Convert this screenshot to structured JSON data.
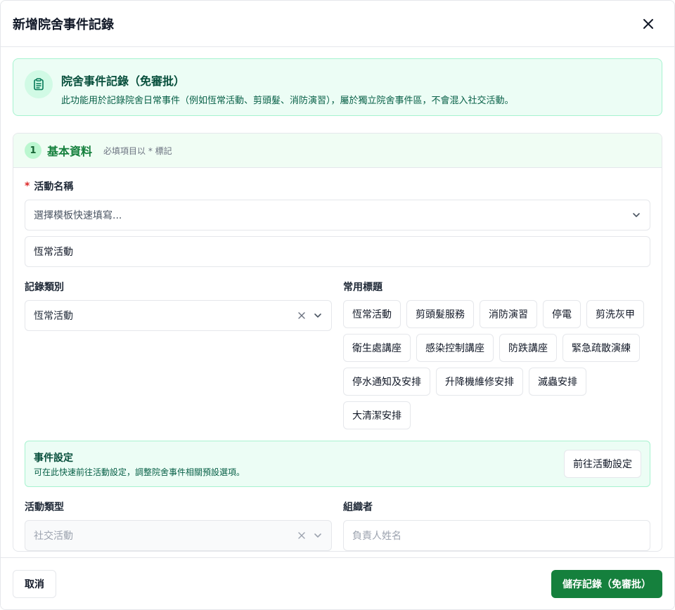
{
  "dialog": {
    "title": "新增院舍事件記錄"
  },
  "banner": {
    "title": "院舍事件記錄（免審批）",
    "description": "此功能用於記錄院舍日常事件（例如恆常活動、剪頭髮、消防演習），屬於獨立院舍事件區，不會混入社交活動。"
  },
  "section": {
    "step": "1",
    "title": "基本資料",
    "hint": "必填項目以 * 標記",
    "activity_name": {
      "required_mark": "*",
      "label": "活動名稱",
      "template_placeholder": "選擇模板快速填寫...",
      "value": "恆常活動"
    },
    "record_category": {
      "label": "記錄類別",
      "value": "恆常活動"
    },
    "common_tags": {
      "label": "常用標題",
      "items": [
        "恆常活動",
        "剪頭髮服務",
        "消防演習",
        "停電",
        "剪洗灰甲",
        "衛生處講座",
        "感染控制講座",
        "防跌講座",
        "緊急疏散演練",
        "停水通知及安排",
        "升降機維修安排",
        "滅蟲安排",
        "大清潔安排"
      ]
    },
    "event_settings": {
      "title": "事件設定",
      "description": "可在此快速前往活動設定，調整院舍事件相關預設選項。",
      "button": "前往活動設定"
    },
    "activity_type": {
      "label": "活動類型",
      "value": "社交活動"
    },
    "organizer": {
      "label": "組織者",
      "placeholder": "負責人姓名"
    }
  },
  "footer": {
    "cancel": "取消",
    "save": "儲存記錄（免審批）"
  },
  "colors": {
    "primary": "#15803d",
    "banner_bg": "#ecfdf5",
    "border": "#e5e7eb"
  }
}
